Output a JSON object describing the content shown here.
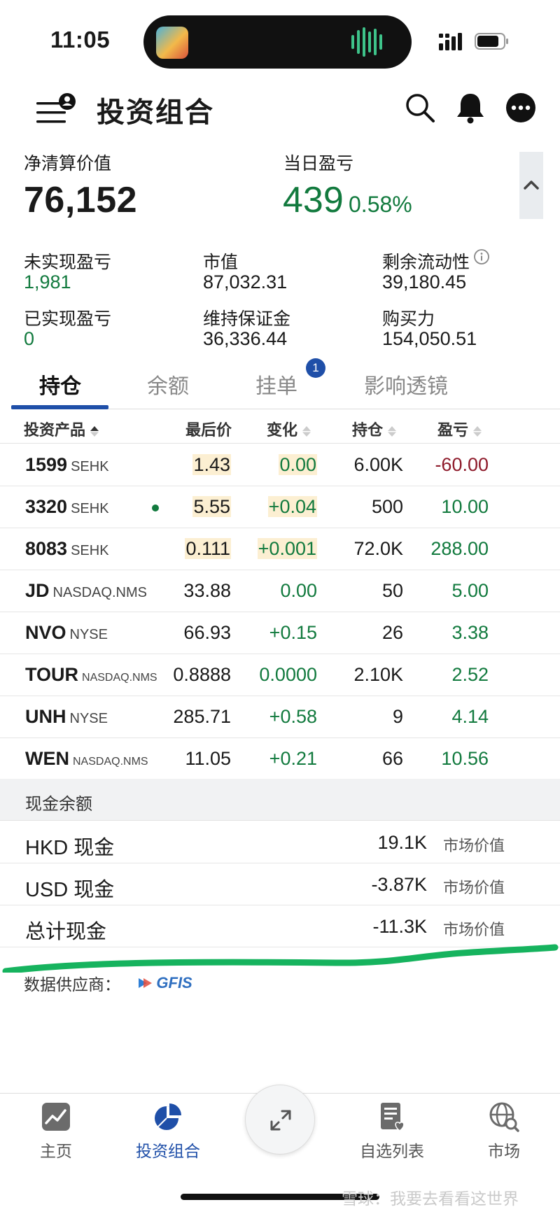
{
  "status_bar": {
    "time": "11:05"
  },
  "header": {
    "title": "投资组合"
  },
  "summary": {
    "net_liq_label": "净清算价值",
    "net_liq_value": "76,152",
    "daily_pnl_label": "当日盈亏",
    "daily_pnl_value": "439",
    "daily_pnl_pct": "0.58%",
    "metrics": [
      {
        "label": "未实现盈亏",
        "value": "1,981"
      },
      {
        "label": "市值",
        "value": "87,032.31"
      },
      {
        "label": "剩余流动性",
        "value": "39,180.45"
      },
      {
        "label": "已实现盈亏",
        "value": "0"
      },
      {
        "label": "维持保证金",
        "value": "36,336.44"
      },
      {
        "label": "购买力",
        "value": "154,050.51"
      }
    ]
  },
  "tabs": [
    {
      "label": "持仓"
    },
    {
      "label": "余额"
    },
    {
      "label": "挂单",
      "badge": "1"
    },
    {
      "label": "影响透镜"
    }
  ],
  "table": {
    "columns": [
      "投资产品",
      "最后价",
      "变化",
      "持仓",
      "盈亏"
    ],
    "rows": [
      {
        "symbol": "1599",
        "exchange": "SEHK",
        "last": "1.43",
        "change": "0.00",
        "position": "6.00K",
        "pnl": "-60.00"
      },
      {
        "symbol": "3320",
        "exchange": "SEHK",
        "last": "5.55",
        "change": "+0.04",
        "position": "500",
        "pnl": "10.00"
      },
      {
        "symbol": "8083",
        "exchange": "SEHK",
        "last": "0.111",
        "change": "+0.001",
        "position": "72.0K",
        "pnl": "288.00"
      },
      {
        "symbol": "JD",
        "exchange": "NASDAQ.NMS",
        "last": "33.88",
        "change": "0.00",
        "position": "50",
        "pnl": "5.00"
      },
      {
        "symbol": "NVO",
        "exchange": "NYSE",
        "last": "66.93",
        "change": "+0.15",
        "position": "26",
        "pnl": "3.38"
      },
      {
        "symbol": "TOUR",
        "exchange": "NASDAQ.NMS",
        "last": "0.8888",
        "change": "0.0000",
        "position": "2.10K",
        "pnl": "2.52"
      },
      {
        "symbol": "UNH",
        "exchange": "NYSE",
        "last": "285.71",
        "change": "+0.58",
        "position": "9",
        "pnl": "4.14"
      },
      {
        "symbol": "WEN",
        "exchange": "NASDAQ.NMS",
        "last": "11.05",
        "change": "+0.21",
        "position": "66",
        "pnl": "10.56"
      }
    ]
  },
  "cash": {
    "title": "现金余额",
    "rows": [
      {
        "name": "HKD 现金",
        "amount": "19.1K",
        "note": "市场价值"
      },
      {
        "name": "USD 现金",
        "amount": "-3.87K",
        "note": "市场价值"
      },
      {
        "name": "总计现金",
        "amount": "-11.3K",
        "note": "市场价值"
      }
    ]
  },
  "provider": {
    "label": "数据供应商：",
    "logo_text": "GFIS"
  },
  "nav": [
    {
      "label": "主页"
    },
    {
      "label": "投资组合"
    },
    {
      "label": "自选列表"
    },
    {
      "label": "市场"
    }
  ],
  "watermark": "雪球：我要去看看这世界",
  "colors": {
    "accent": "#1f4fa8",
    "positive": "#127a3e",
    "negative": "#8e1b2b",
    "highlight": "#fcefd2"
  }
}
